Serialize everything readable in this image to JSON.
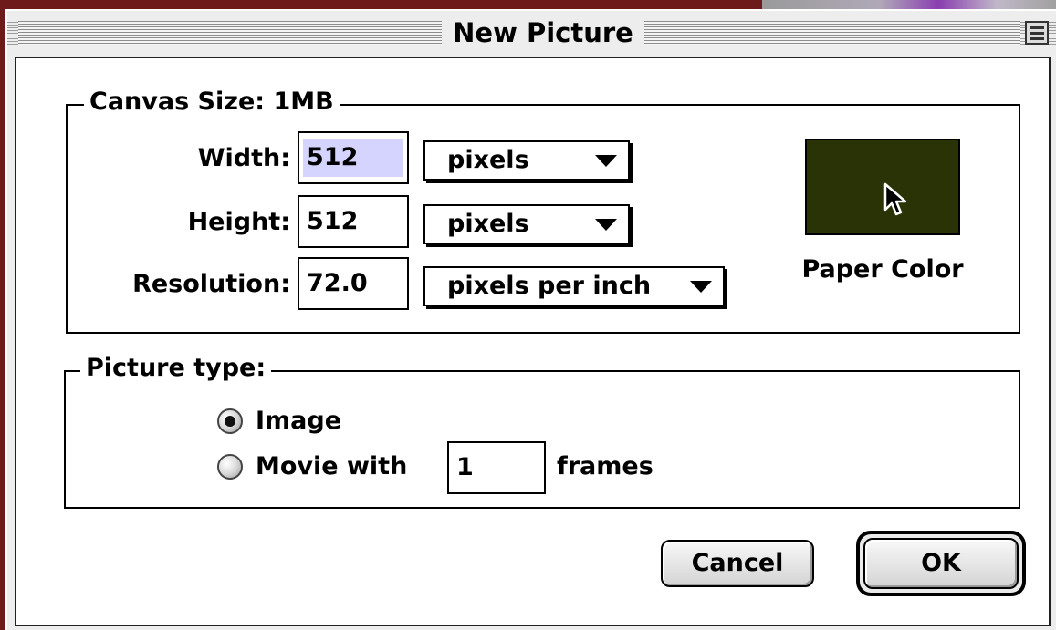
{
  "window": {
    "title": "New Picture"
  },
  "canvas_group": {
    "label": "Canvas Size: 1MB",
    "width": {
      "label": "Width:",
      "value": "512",
      "unit": "pixels"
    },
    "height": {
      "label": "Height:",
      "value": "512",
      "unit": "pixels"
    },
    "resolution": {
      "label": "Resolution:",
      "value": "72.0",
      "unit": "pixels per inch"
    },
    "paper_color": {
      "label": "Paper Color",
      "color": "#2a3305"
    }
  },
  "picture_type_group": {
    "label": "Picture type:",
    "image_label": "Image",
    "movie_label": "Movie with",
    "frames_value": "1",
    "frames_label": "frames",
    "selected": "Image"
  },
  "buttons": {
    "cancel": "Cancel",
    "ok": "OK"
  }
}
